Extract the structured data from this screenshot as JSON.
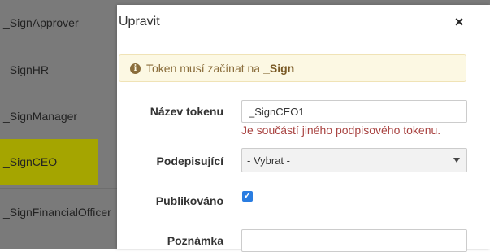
{
  "background_table": {
    "rows": [
      {
        "label": "_SignApprover"
      },
      {
        "label": "_SignHR"
      },
      {
        "label": "_SignManager"
      },
      {
        "label": "_SignCEO"
      },
      {
        "label": "_SignFinancialOfficer"
      }
    ],
    "highlight_color": "#a5a500"
  },
  "modal": {
    "title": "Upravit",
    "close_icon": "×",
    "alert": {
      "icon": "i",
      "text": "Token musí začínat na",
      "emphasis": "_Sign"
    },
    "form": {
      "token_name_label": "Název tokenu",
      "token_name_value": "_SignCEO1",
      "token_name_error": "Je součástí jiného podpisového tokenu.",
      "signer_label": "Podepisující",
      "signer_selected": "- Vybrat -",
      "published_label": "Publikováno",
      "published_checked": true,
      "published_check_glyph": "✓",
      "note_label": "Poznámka",
      "note_value": ""
    }
  }
}
